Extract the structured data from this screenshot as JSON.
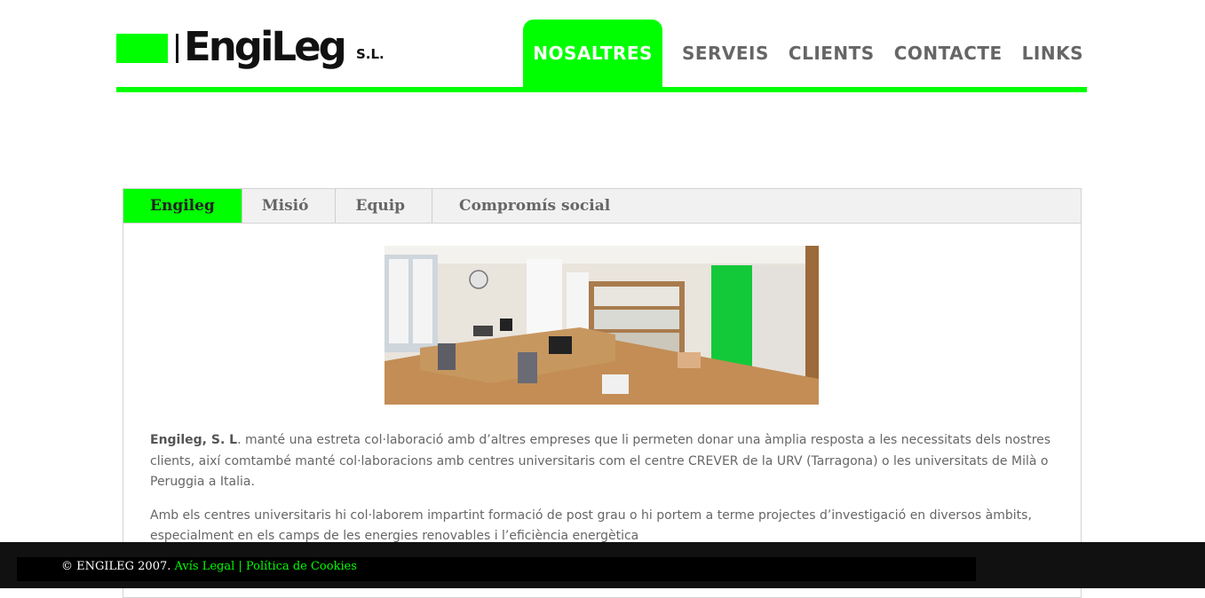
{
  "brand": {
    "name": "EngiLeg",
    "suffix": "S.L.",
    "accent_color": "#00ff00"
  },
  "nav": {
    "items": [
      {
        "label": "NOSALTRES",
        "active": true
      },
      {
        "label": "SERVEIS"
      },
      {
        "label": "CLIENTS"
      },
      {
        "label": "CONTACTE"
      },
      {
        "label": "LINKS"
      }
    ]
  },
  "tabs": [
    {
      "label": "Engileg",
      "active": true
    },
    {
      "label": "Misió"
    },
    {
      "label": "Equip"
    },
    {
      "label": "Compromís social"
    }
  ],
  "content": {
    "photo_alt": "office-photo",
    "p1_bold": "Engileg, S. L",
    "p1_rest": ". manté una estreta col·laboració amb d’altres empreses que li permeten donar una àmplia resposta a les necessitats dels nostres clients, així comtambé manté col·laboracions amb centres universitaris com el centre CREVER de la URV (Tarragona) o les universitats de Milà o Peruggia a Italia.",
    "p2": "Amb els centres universitaris hi col·laborem impartint formació de post grau o hi portem a terme projectes d’investigació en diversos àmbits, especialment en els camps de les energies renovables i l’eficiència energètica"
  },
  "footer": {
    "copyright": "© ENGILEG 2007.",
    "legal_link": "Avís Legal",
    "separator": "|",
    "cookies_link": "Política de Cookies"
  }
}
